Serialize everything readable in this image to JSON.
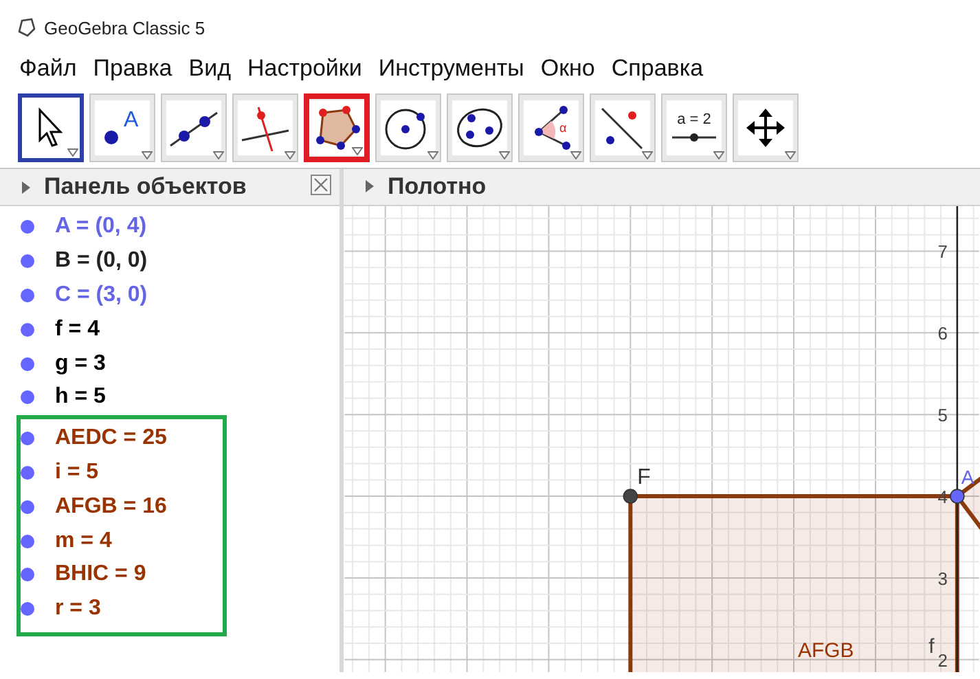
{
  "window": {
    "title": "GeoGebra Classic 5"
  },
  "menu": [
    "Файл",
    "Правка",
    "Вид",
    "Настройки",
    "Инструменты",
    "Окно",
    "Справка"
  ],
  "toolbar": [
    {
      "kind": "move",
      "selected": true,
      "annotated": false
    },
    {
      "kind": "point",
      "label": "A",
      "selected": false,
      "annotated": false
    },
    {
      "kind": "line",
      "selected": false,
      "annotated": false
    },
    {
      "kind": "perpendicular",
      "selected": false,
      "annotated": false
    },
    {
      "kind": "polygon",
      "selected": false,
      "annotated": true
    },
    {
      "kind": "circle",
      "selected": false,
      "annotated": false
    },
    {
      "kind": "ellipse",
      "selected": false,
      "annotated": false
    },
    {
      "kind": "angle",
      "label": "α",
      "selected": false,
      "annotated": false
    },
    {
      "kind": "reflect",
      "selected": false,
      "annotated": false
    },
    {
      "kind": "slider",
      "label": "a = 2",
      "selected": false,
      "annotated": false
    },
    {
      "kind": "pan",
      "selected": false,
      "annotated": false
    }
  ],
  "algebra_panel": {
    "title": "Панель объектов",
    "objects": [
      {
        "text": "A = (0, 4)",
        "color": "#6464e6"
      },
      {
        "text": "B = (0, 0)",
        "color": "#222222"
      },
      {
        "text": "C = (3, 0)",
        "color": "#6464e6"
      },
      {
        "text": "f = 4",
        "color": "#000000"
      },
      {
        "text": "g = 3",
        "color": "#000000"
      },
      {
        "text": "h = 5",
        "color": "#000000"
      }
    ],
    "highlighted_objects": [
      {
        "text": "AEDC = 25",
        "color": "#993300"
      },
      {
        "text": "i = 5",
        "color": "#993300"
      },
      {
        "text": "AFGB = 16",
        "color": "#993300"
      },
      {
        "text": "m = 4",
        "color": "#993300"
      },
      {
        "text": "BHIC = 9",
        "color": "#993300"
      },
      {
        "text": "r = 3",
        "color": "#993300"
      }
    ]
  },
  "graphics_view": {
    "title": "Полотно",
    "y_axis_labels": [
      "7",
      "6",
      "5",
      "4",
      "3",
      "2"
    ],
    "point_labels": [
      "F",
      "A"
    ],
    "polygon_label": "AFGB",
    "segment_label": "f"
  }
}
